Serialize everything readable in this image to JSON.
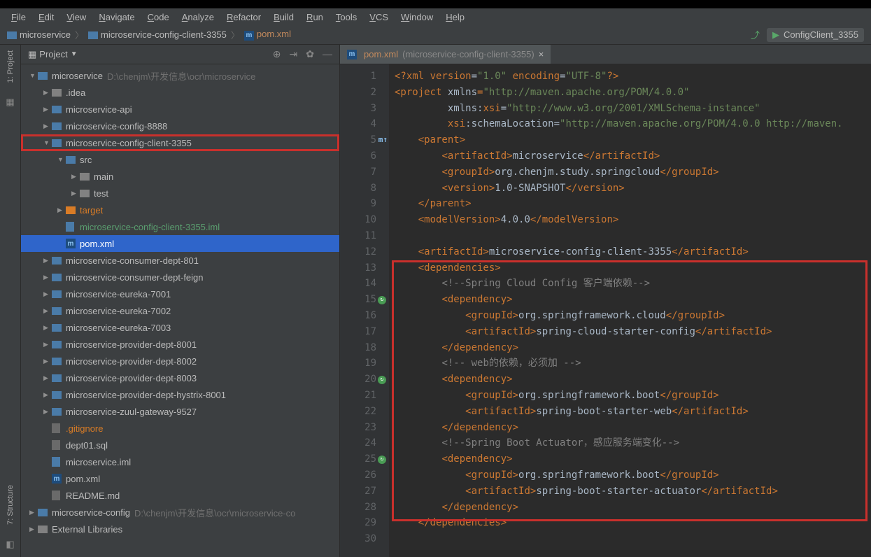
{
  "menubar": [
    "File",
    "Edit",
    "View",
    "Navigate",
    "Code",
    "Analyze",
    "Refactor",
    "Build",
    "Run",
    "Tools",
    "VCS",
    "Window",
    "Help"
  ],
  "breadcrumb": {
    "folder1": "microservice",
    "folder2": "microservice-config-client-3355",
    "file": "pom.xml"
  },
  "runConfig": "ConfigClient_3355",
  "panel": {
    "title": "Project"
  },
  "tree": [
    {
      "depth": 0,
      "arrow": "▼",
      "iconType": "folder-mod",
      "name": "microservice",
      "path": "D:\\chenjm\\开发信息\\ocr\\microservice",
      "color": "#bbb"
    },
    {
      "depth": 1,
      "arrow": "▶",
      "iconType": "folder-std",
      "name": ".idea"
    },
    {
      "depth": 1,
      "arrow": "▶",
      "iconType": "folder-mod",
      "name": "microservice-api"
    },
    {
      "depth": 1,
      "arrow": "▶",
      "iconType": "folder-mod",
      "name": "microservice-config-8888"
    },
    {
      "depth": 1,
      "arrow": "▼",
      "iconType": "folder-mod",
      "name": "microservice-config-client-3355",
      "highlighted": true
    },
    {
      "depth": 2,
      "arrow": "▼",
      "iconType": "folder-mod",
      "name": "src"
    },
    {
      "depth": 3,
      "arrow": "▶",
      "iconType": "folder-std",
      "name": "main"
    },
    {
      "depth": 3,
      "arrow": "▶",
      "iconType": "folder-std",
      "name": "test"
    },
    {
      "depth": 2,
      "arrow": "▶",
      "iconType": "folder-orange",
      "name": "target",
      "color": "#d97c26"
    },
    {
      "depth": 2,
      "arrow": "",
      "iconType": "file-iml",
      "name": "microservice-config-client-3355.iml",
      "color": "#5a9e6f"
    },
    {
      "depth": 2,
      "arrow": "",
      "iconType": "m-icon",
      "name": "pom.xml",
      "selected": true
    },
    {
      "depth": 1,
      "arrow": "▶",
      "iconType": "folder-mod",
      "name": "microservice-consumer-dept-801"
    },
    {
      "depth": 1,
      "arrow": "▶",
      "iconType": "folder-mod",
      "name": "microservice-consumer-dept-feign"
    },
    {
      "depth": 1,
      "arrow": "▶",
      "iconType": "folder-mod",
      "name": "microservice-eureka-7001"
    },
    {
      "depth": 1,
      "arrow": "▶",
      "iconType": "folder-mod",
      "name": "microservice-eureka-7002"
    },
    {
      "depth": 1,
      "arrow": "▶",
      "iconType": "folder-mod",
      "name": "microservice-eureka-7003"
    },
    {
      "depth": 1,
      "arrow": "▶",
      "iconType": "folder-mod",
      "name": "microservice-provider-dept-8001"
    },
    {
      "depth": 1,
      "arrow": "▶",
      "iconType": "folder-mod",
      "name": "microservice-provider-dept-8002"
    },
    {
      "depth": 1,
      "arrow": "▶",
      "iconType": "folder-mod",
      "name": "microservice-provider-dept-8003"
    },
    {
      "depth": 1,
      "arrow": "▶",
      "iconType": "folder-mod",
      "name": "microservice-provider-dept-hystrix-8001"
    },
    {
      "depth": 1,
      "arrow": "▶",
      "iconType": "folder-mod",
      "name": "microservice-zuul-gateway-9527"
    },
    {
      "depth": 1,
      "arrow": "",
      "iconType": "file-generic",
      "name": ".gitignore",
      "color": "#d97c26"
    },
    {
      "depth": 1,
      "arrow": "",
      "iconType": "file-generic",
      "name": "dept01.sql"
    },
    {
      "depth": 1,
      "arrow": "",
      "iconType": "file-iml",
      "name": "microservice.iml"
    },
    {
      "depth": 1,
      "arrow": "",
      "iconType": "m-icon",
      "name": "pom.xml"
    },
    {
      "depth": 1,
      "arrow": "",
      "iconType": "file-generic",
      "name": "README.md"
    },
    {
      "depth": 0,
      "arrow": "▶",
      "iconType": "folder-mod",
      "name": "microservice-config",
      "path": "D:\\chenjm\\开发信息\\ocr\\microservice-co",
      "color": "#bbb"
    },
    {
      "depth": 0,
      "arrow": "▶",
      "iconType": "folder-std",
      "name": "External Libraries"
    }
  ],
  "editorTab": {
    "file": "pom.xml",
    "context": "(microservice-config-client-3355)"
  },
  "code": [
    {
      "n": 1,
      "html": "<span class='decl'>&lt;?</span><span class='tag'>xml version</span><span class='attr'>=</span><span class='val'>\"1.0\"</span> <span class='tag'>encoding</span><span class='attr'>=</span><span class='val'>\"UTF-8\"</span><span class='decl'>?&gt;</span>"
    },
    {
      "n": 2,
      "html": "<span class='tag'>&lt;project </span><span class='attr'>xmlns</span><span class='tag'>=</span><span class='val'>\"http://maven.apache.org/POM/4.0.0\"</span>"
    },
    {
      "n": 3,
      "html": "         <span class='attr'>xmlns:</span><span class='tag'>xsi</span><span class='attr'>=</span><span class='val'>\"http://www.w3.org/2001/XMLSchema-instance\"</span>"
    },
    {
      "n": 4,
      "html": "         <span class='tag'>xsi</span><span class='attr'>:schemaLocation=</span><span class='val'>\"http://maven.apache.org/POM/4.0.0 http://maven.</span>"
    },
    {
      "n": 5,
      "html": "    <span class='tag'>&lt;parent&gt;</span>",
      "badge": "m↑"
    },
    {
      "n": 6,
      "html": "        <span class='tag'>&lt;artifactId&gt;</span><span class='text'>microservice</span><span class='tag'>&lt;/artifactId&gt;</span>"
    },
    {
      "n": 7,
      "html": "        <span class='tag'>&lt;groupId&gt;</span><span class='text'>org.chenjm.study.springcloud</span><span class='tag'>&lt;/groupId&gt;</span>"
    },
    {
      "n": 8,
      "html": "        <span class='tag'>&lt;version&gt;</span><span class='text'>1.0-SNAPSHOT</span><span class='tag'>&lt;/version&gt;</span>"
    },
    {
      "n": 9,
      "html": "    <span class='tag'>&lt;/parent&gt;</span>"
    },
    {
      "n": 10,
      "html": "    <span class='tag'>&lt;modelVersion&gt;</span><span class='text'>4.0.0</span><span class='tag'>&lt;/modelVersion&gt;</span>"
    },
    {
      "n": 11,
      "html": ""
    },
    {
      "n": 12,
      "html": "    <span class='tag'>&lt;artifactId&gt;</span><span class='text'>microservice-config-client-3355</span><span class='tag'>&lt;/artifactId&gt;</span>"
    },
    {
      "n": 13,
      "html": "    <span class='tag'>&lt;dependencies&gt;</span>"
    },
    {
      "n": 14,
      "html": "        <span class='comment'>&lt;!--Spring Cloud Config 客户端依赖--&gt;</span>"
    },
    {
      "n": 15,
      "html": "        <span class='tag'>&lt;dependency&gt;</span>",
      "marker": "↻"
    },
    {
      "n": 16,
      "html": "            <span class='tag'>&lt;groupId&gt;</span><span class='text'>org.springframework.cloud</span><span class='tag'>&lt;/groupId&gt;</span>"
    },
    {
      "n": 17,
      "html": "            <span class='tag'>&lt;artifactId&gt;</span><span class='text'>spring-cloud-starter-config</span><span class='tag'>&lt;/artifactId&gt;</span>"
    },
    {
      "n": 18,
      "html": "        <span class='tag'>&lt;/dependency&gt;</span>"
    },
    {
      "n": 19,
      "html": "        <span class='comment'>&lt;!-- web的依赖，必须加 --&gt;</span>"
    },
    {
      "n": 20,
      "html": "        <span class='tag'>&lt;dependency&gt;</span>",
      "marker": "↻"
    },
    {
      "n": 21,
      "html": "            <span class='tag'>&lt;groupId&gt;</span><span class='text'>org.springframework.boot</span><span class='tag'>&lt;/groupId&gt;</span>"
    },
    {
      "n": 22,
      "html": "            <span class='tag'>&lt;artifactId&gt;</span><span class='text'>spring-boot-starter-web</span><span class='tag'>&lt;/artifactId&gt;</span>"
    },
    {
      "n": 23,
      "html": "        <span class='tag'>&lt;/dependency&gt;</span>"
    },
    {
      "n": 24,
      "html": "        <span class='comment'>&lt;!--Spring Boot Actuator，感应服务端变化--&gt;</span>"
    },
    {
      "n": 25,
      "html": "        <span class='tag'>&lt;dependency&gt;</span>",
      "marker": "↻"
    },
    {
      "n": 26,
      "html": "            <span class='tag'>&lt;groupId&gt;</span><span class='text'>org.springframework.boot</span><span class='tag'>&lt;/groupId&gt;</span>"
    },
    {
      "n": 27,
      "html": "            <span class='tag'>&lt;artifactId&gt;</span><span class='text'>spring-boot-starter-actuator</span><span class='tag'>&lt;/artifactId&gt;</span>"
    },
    {
      "n": 28,
      "html": "        <span class='tag'>&lt;/dependency&gt;</span>"
    },
    {
      "n": 29,
      "html": "    <span class='tag'>&lt;/dependencies&gt;</span>"
    },
    {
      "n": 30,
      "html": ""
    }
  ],
  "sidebarTabs": {
    "project": "1: Project",
    "structure": "7: Structure"
  }
}
